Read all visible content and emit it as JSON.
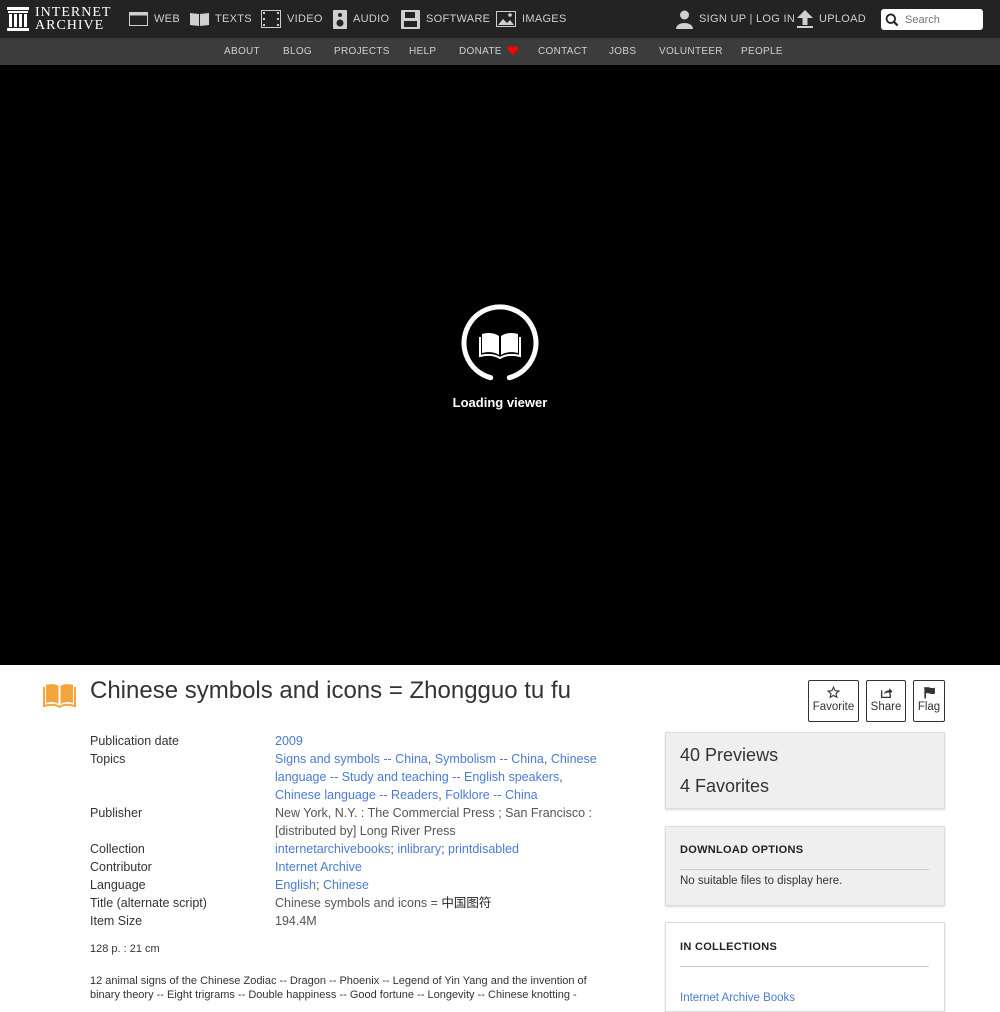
{
  "header": {
    "logo_line1": "INTERNET",
    "logo_line2": "ARCHIVE",
    "nav": [
      {
        "label": "WEB",
        "icon": "web-icon"
      },
      {
        "label": "TEXTS",
        "icon": "texts-icon"
      },
      {
        "label": "VIDEO",
        "icon": "video-icon"
      },
      {
        "label": "AUDIO",
        "icon": "audio-icon"
      },
      {
        "label": "SOFTWARE",
        "icon": "software-icon"
      },
      {
        "label": "IMAGES",
        "icon": "images-icon"
      }
    ],
    "signup_login": "SIGN UP | LOG IN",
    "upload": "UPLOAD",
    "search_placeholder": "Search"
  },
  "subnav": [
    "ABOUT",
    "BLOG",
    "PROJECTS",
    "HELP",
    "DONATE",
    "CONTACT",
    "JOBS",
    "VOLUNTEER",
    "PEOPLE"
  ],
  "viewer": {
    "loading_text": "Loading viewer"
  },
  "item": {
    "title": "Chinese symbols and icons = Zhongguo tu fu",
    "actions": {
      "favorite": "Favorite",
      "share": "Share",
      "flag": "Flag"
    },
    "metadata": {
      "publication_date": {
        "label": "Publication date",
        "value": "2009"
      },
      "topics": {
        "label": "Topics",
        "values": [
          "Signs and symbols -- China",
          "Symbolism -- China",
          "Chinese language -- Study and teaching -- English speakers",
          "Chinese language -- Readers",
          "Folklore -- China"
        ]
      },
      "publisher": {
        "label": "Publisher",
        "value": "New York, N.Y. : The Commercial Press ; San Francisco : [distributed by] Long River Press"
      },
      "collection": {
        "label": "Collection",
        "values": [
          "internetarchivebooks",
          "inlibrary",
          "printdisabled"
        ]
      },
      "contributor": {
        "label": "Contributor",
        "value": "Internet Archive"
      },
      "language": {
        "label": "Language",
        "values": [
          "English",
          "Chinese"
        ]
      },
      "alt_title": {
        "label": "Title (alternate script)",
        "value_prefix": "Chinese symbols and icons = ",
        "value_script": "中国图符"
      },
      "item_size": {
        "label": "Item Size",
        "value": "194.4M"
      }
    },
    "size_note": "128 p. : 21 cm",
    "description": "12 animal signs of the Chinese Zodiac -- Dragon -- Phoenix -- Legend of Yin Yang and the invention of binary theory -- Eight trigrams -- Double happiness -- Good fortune -- Longevity -- Chinese knotting -"
  },
  "sidebar": {
    "previews_count": "40",
    "previews_label": "Previews",
    "favorites_count": "4",
    "favorites_label": "Favorites",
    "download_heading": "DOWNLOAD OPTIONS",
    "download_empty": "No suitable files to display here.",
    "collections_heading": "IN COLLECTIONS",
    "collection_item": "Internet Archive Books"
  },
  "colors": {
    "link": "#4b7bd1",
    "texts_icon": "#f1a53a",
    "donate_heart": "#ff0000",
    "header_bg": "#232323",
    "subnav_bg": "#3c3c3c"
  }
}
